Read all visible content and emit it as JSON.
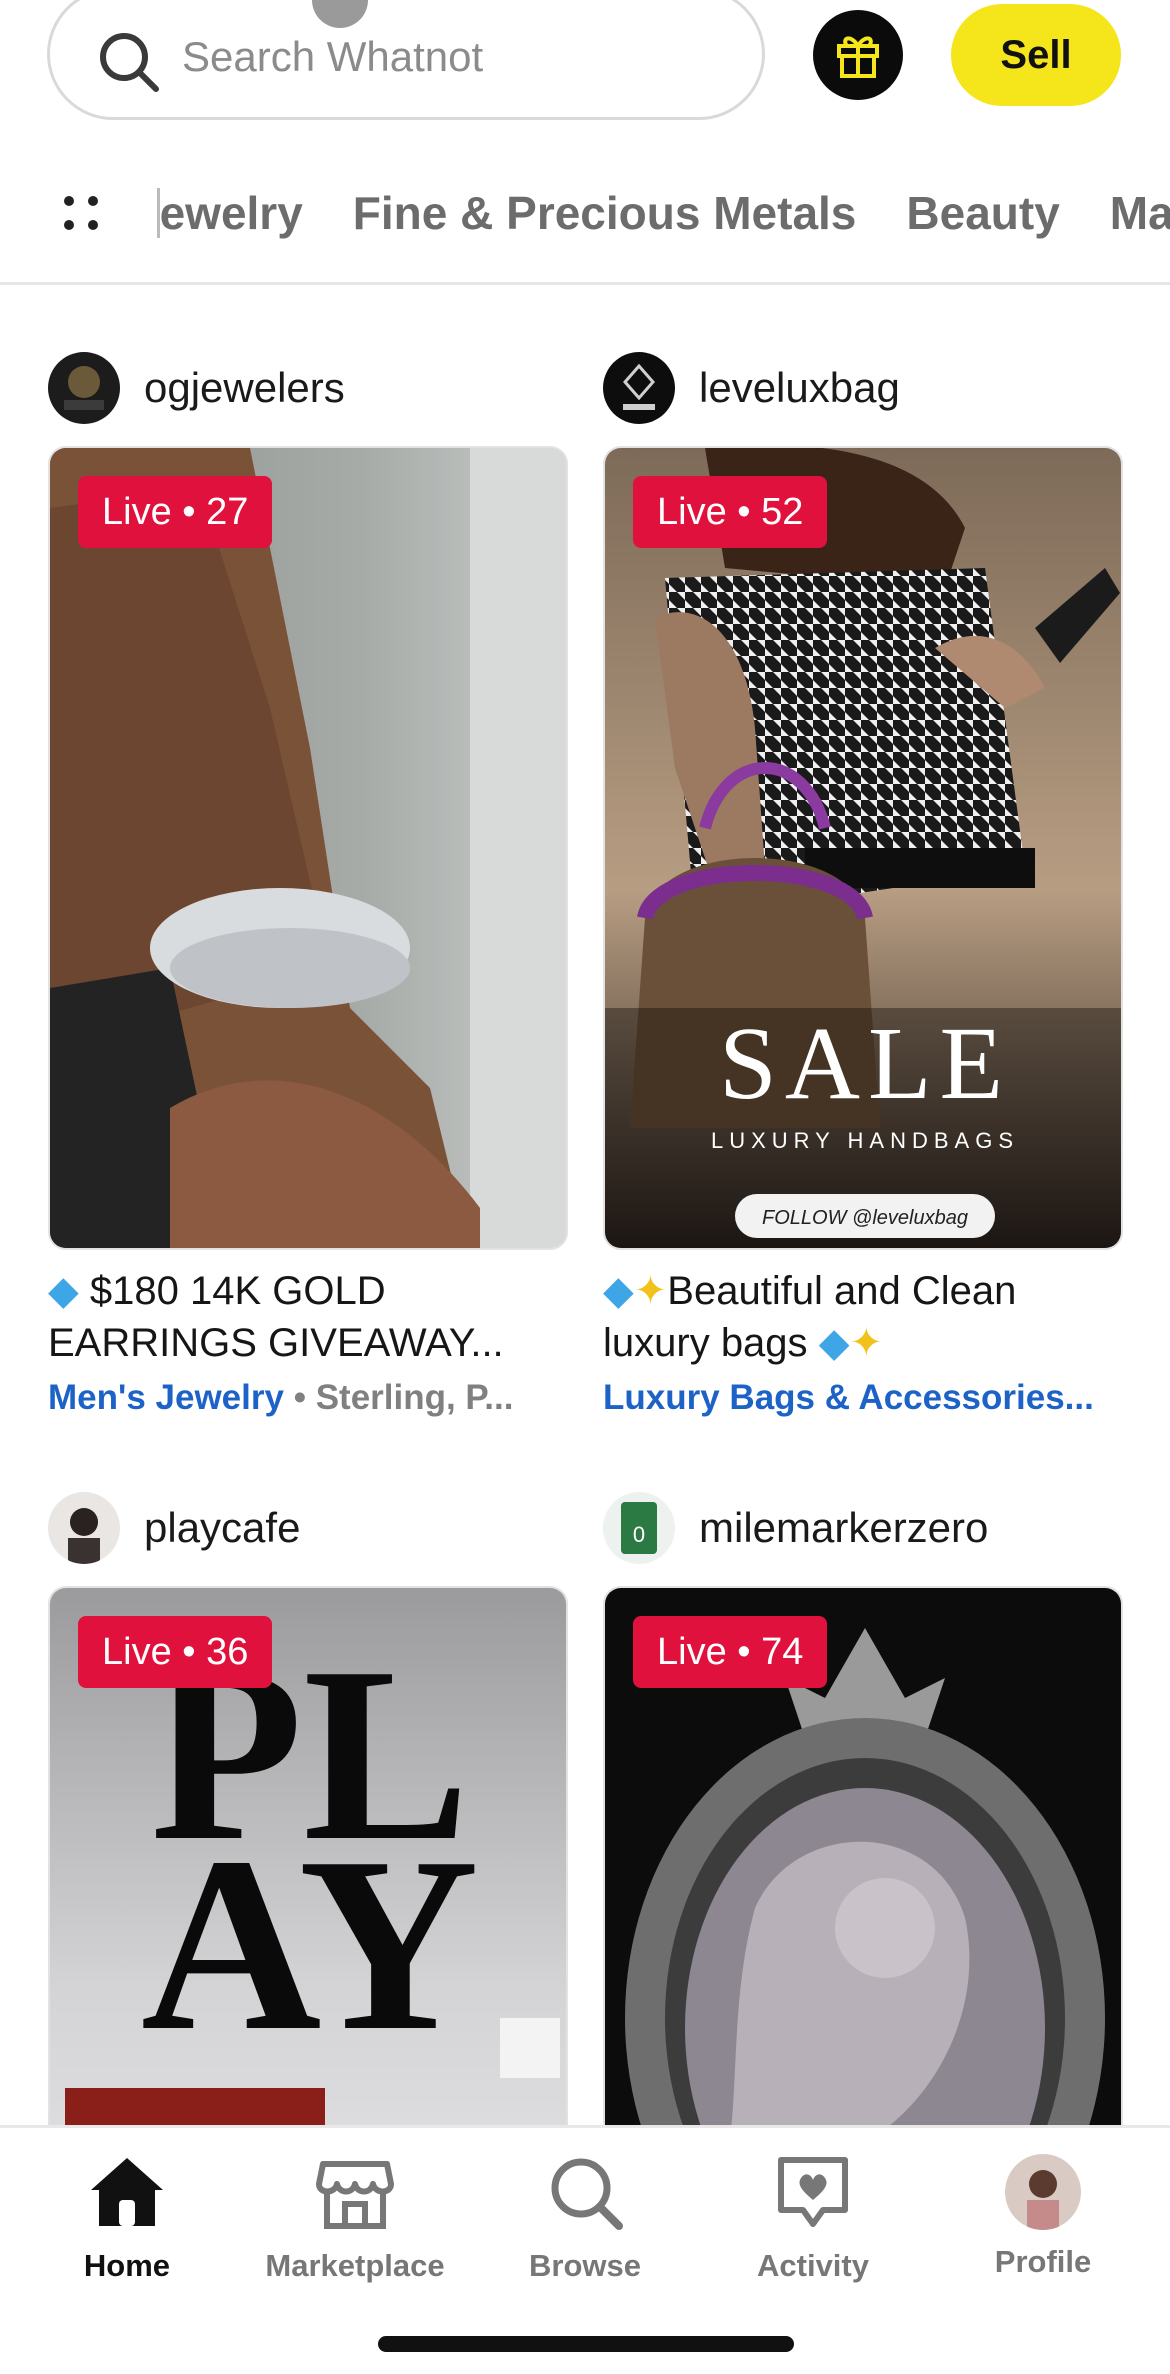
{
  "header": {
    "search_placeholder": "Search Whatnot",
    "sell_label": "Sell"
  },
  "categories": [
    "Jewelry",
    "Fine & Precious Metals",
    "Beauty",
    "Ma"
  ],
  "feed": [
    {
      "seller": "ogjewelers",
      "live_label": "Live • 27",
      "title_text": "$180 14K GOLD EARRINGS GIVEAWAY...",
      "category": "Men's Jewelry",
      "separator": "•",
      "subcategory": "Sterling, P..."
    },
    {
      "seller": "leveluxbag",
      "live_label": "Live • 52",
      "title_text_1": "Beautiful and Clean luxury bags",
      "category": "Luxury Bags & Accessories...",
      "image_text": {
        "headline": "SALE",
        "subline": "LUXURY HANDBAGS",
        "follow": "FOLLOW @leveluxbag"
      }
    },
    {
      "seller": "playcafe",
      "live_label": "Live • 36",
      "image_text": {
        "line1": "PL",
        "line2": "AY"
      }
    },
    {
      "seller": "milemarkerzero",
      "live_label": "Live • 74"
    }
  ],
  "nav": {
    "home": "Home",
    "marketplace": "Marketplace",
    "browse": "Browse",
    "activity": "Activity",
    "profile": "Profile"
  },
  "colors": {
    "live_red": "#e0123d",
    "sell_yellow": "#f5e51b",
    "link_blue": "#1d63c7"
  },
  "icons": [
    "search-icon",
    "gift-icon",
    "grid-icon",
    "home-icon",
    "marketplace-icon",
    "browse-icon",
    "activity-icon",
    "diamond-icon",
    "sparkles-icon"
  ]
}
